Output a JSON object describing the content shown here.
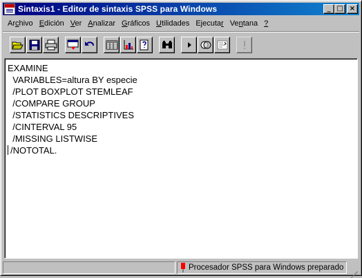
{
  "window": {
    "title": "Sintaxis1 - Editor de sintaxis SPSS para Windows",
    "controls": {
      "minimize": "_",
      "maximize": "□",
      "close": "×"
    }
  },
  "menu": {
    "items": [
      {
        "label": "Archivo",
        "pre": "Ar",
        "ul": "c",
        "post": "hivo"
      },
      {
        "label": "Edición",
        "pre": "",
        "ul": "E",
        "post": "dición"
      },
      {
        "label": "Ver",
        "pre": "",
        "ul": "V",
        "post": "er"
      },
      {
        "label": "Analizar",
        "pre": "",
        "ul": "A",
        "post": "nalizar"
      },
      {
        "label": "Gráficos",
        "pre": "",
        "ul": "G",
        "post": "ráficos"
      },
      {
        "label": "Utilidades",
        "pre": "",
        "ul": "U",
        "post": "tilidades"
      },
      {
        "label": "Ejecutar",
        "pre": "Ejecuta",
        "ul": "r",
        "post": ""
      },
      {
        "label": "Ventana",
        "pre": "Ve",
        "ul": "n",
        "post": "tana"
      },
      {
        "label": "?",
        "pre": "",
        "ul": "?",
        "post": ""
      }
    ]
  },
  "toolbar": {
    "buttons": [
      {
        "icon": "open-folder-icon"
      },
      {
        "icon": "save-disk-icon"
      },
      {
        "icon": "print-icon"
      },
      {
        "icon": "dialog-recall-icon"
      },
      {
        "icon": "undo-icon"
      },
      {
        "icon": "data-editor-icon"
      },
      {
        "icon": "goto-chart-icon"
      },
      {
        "icon": "variables-info-icon"
      },
      {
        "icon": "find-binoculars-icon"
      },
      {
        "icon": "run-icon"
      },
      {
        "icon": "use-sets-icon"
      },
      {
        "icon": "syntax-help-icon"
      },
      {
        "icon": "designate-window-icon"
      }
    ]
  },
  "editor": {
    "lines": [
      "EXAMINE",
      "  VARIABLES=altura BY especie",
      "  /PLOT BOXPLOT STEMLEAF",
      "  /COMPARE GROUP",
      "  /STATISTICS DESCRIPTIVES",
      "  /CINTERVAL 95",
      "  /MISSING LISTWISE",
      "/NOTOTAL."
    ]
  },
  "status": {
    "text": "Procesador SPSS para Windows preparado",
    "indicator_color": "#ff0000"
  }
}
